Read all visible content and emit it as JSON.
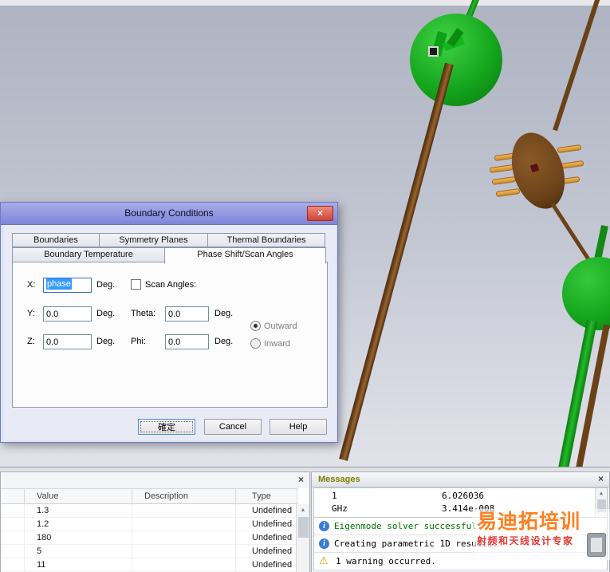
{
  "colors": {
    "selection_blue": "#3399ff",
    "success_green": "#007700",
    "sphere_green": "#14a41c",
    "rod_brown": "#6b4218",
    "pin_orange": "#e0a23c",
    "messages_title_olive": "#808000",
    "watermark_orange": "#ff7f1f",
    "watermark_red": "#e53935"
  },
  "icons": {
    "close": "×",
    "info": "i",
    "warning": "⚠",
    "scroll_up": "▲",
    "scroll_down": "▼"
  },
  "dialog": {
    "title": "Boundary Conditions",
    "tabs_row1": [
      {
        "label": "Boundaries"
      },
      {
        "label": "Symmetry Planes"
      },
      {
        "label": "Thermal Boundaries"
      }
    ],
    "tabs_row2": [
      {
        "label": "Boundary Temperature"
      },
      {
        "label": "Phase Shift/Scan Angles"
      }
    ],
    "form": {
      "x_label": "X:",
      "x_value": "phase",
      "y_label": "Y:",
      "y_value": "0.0",
      "z_label": "Z:",
      "z_value": "0.0",
      "theta_label": "Theta:",
      "theta_value": "0.0",
      "phi_label": "Phi:",
      "phi_value": "0.0",
      "deg": "Deg.",
      "scan_angles_label": "Scan Angles:",
      "outward_label": "Outward",
      "inward_label": "Inward"
    },
    "buttons": {
      "ok": "確定",
      "cancel": "Cancel",
      "help": "Help"
    }
  },
  "param_table": {
    "headers": {
      "value": "Value",
      "description": "Description",
      "type": "Type"
    },
    "rows": [
      {
        "value": "1.3",
        "description": "",
        "type": "Undefined"
      },
      {
        "value": "1.2",
        "description": "",
        "type": "Undefined"
      },
      {
        "value": "180",
        "description": "",
        "type": "Undefined"
      },
      {
        "value": "5",
        "description": "",
        "type": "Undefined"
      },
      {
        "value": "11",
        "description": "",
        "type": "Undefined"
      }
    ]
  },
  "messages": {
    "title": "Messages",
    "freq_table": [
      {
        "c1": "1",
        "c2": "6.026036"
      },
      {
        "c1": "GHz",
        "c2": "3.414e-008"
      }
    ],
    "lines": [
      {
        "text": "Eigenmode solver successful"
      },
      {
        "text": "Creating parametric 1D results."
      },
      {
        "text": "1 warning occurred."
      }
    ]
  },
  "watermark": {
    "title": "易迪拓培训",
    "subtitle": "射频和天线设计专家"
  }
}
